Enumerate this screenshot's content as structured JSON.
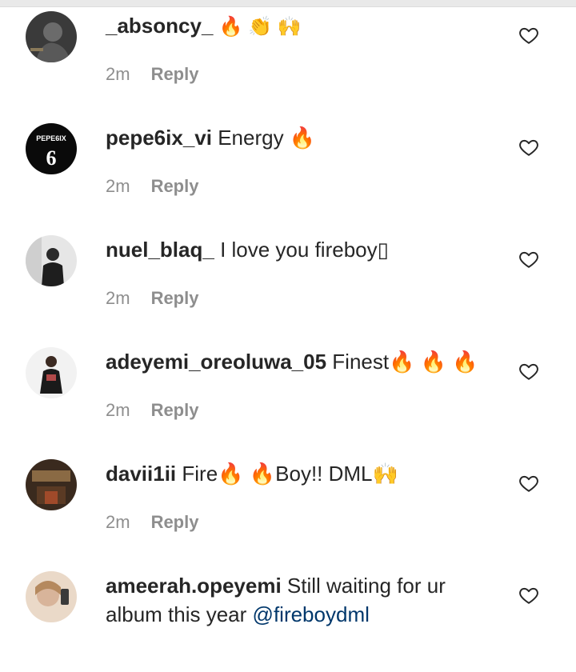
{
  "comments": [
    {
      "username": "_absoncy_",
      "text": "🔥 👏 🙌",
      "time": "2m",
      "reply": "Reply"
    },
    {
      "username": "pepe6ix_vi",
      "text": "Energy 🔥",
      "time": "2m",
      "reply": "Reply",
      "avatar_text": "PEPE6IX",
      "avatar_number": "6"
    },
    {
      "username": "nuel_blaq_",
      "text": "I love you fireboy▯",
      "time": "2m",
      "reply": "Reply"
    },
    {
      "username": "adeyemi_oreoluwa_05",
      "text": "Finest🔥 🔥 🔥",
      "time": "2m",
      "reply": "Reply"
    },
    {
      "username": "davii1ii",
      "text": "Fire🔥 🔥Boy!! DML🙌",
      "time": "2m",
      "reply": "Reply"
    },
    {
      "username": "ameerah.opeyemi",
      "text": "Still waiting for ur album this year",
      "mention": "@fireboydml",
      "time": "",
      "reply": ""
    }
  ],
  "icons": {
    "like": "heart-outline-icon"
  },
  "colors": {
    "text": "#262626",
    "meta": "#8e8e8e",
    "mention": "#00376b"
  }
}
